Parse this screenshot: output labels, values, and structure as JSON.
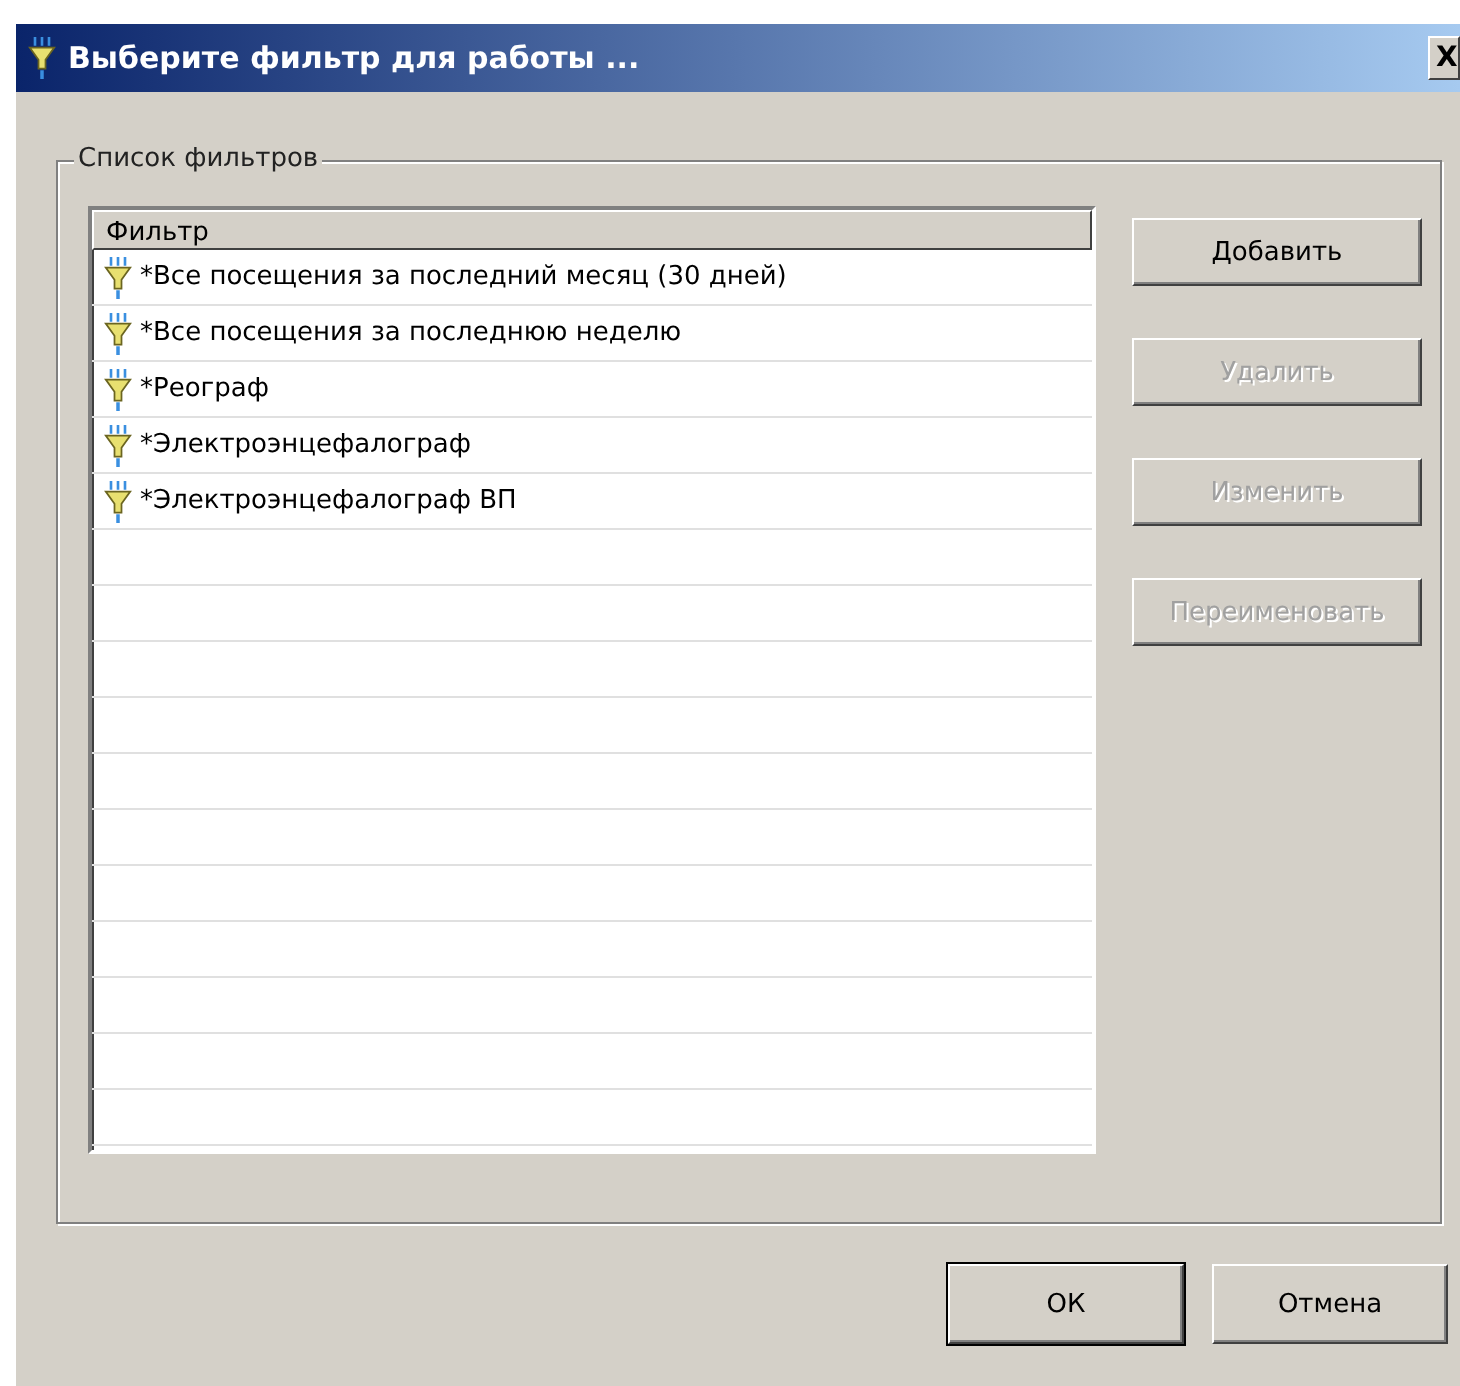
{
  "window": {
    "title": "Выберите фильтр для работы ...",
    "close": "X"
  },
  "group": {
    "title": "Список фильтров"
  },
  "list": {
    "column": "Фильтр",
    "rows": [
      {
        "label": "*Все посещения за последний месяц (30 дней)"
      },
      {
        "label": "*Все посещения за последнюю неделю"
      },
      {
        "label": "*Реограф"
      },
      {
        "label": "*Электроэнцефалограф"
      },
      {
        "label": "*Электроэнцефалограф ВП"
      }
    ]
  },
  "side_buttons": [
    {
      "label": "Добавить",
      "disabled": false
    },
    {
      "label": "Удалить",
      "disabled": true
    },
    {
      "label": "Изменить",
      "disabled": true
    },
    {
      "label": "Переименовать",
      "disabled": true
    }
  ],
  "buttons": [
    {
      "label": "ОК",
      "default": true
    },
    {
      "label": "Отмена",
      "default": false
    }
  ]
}
